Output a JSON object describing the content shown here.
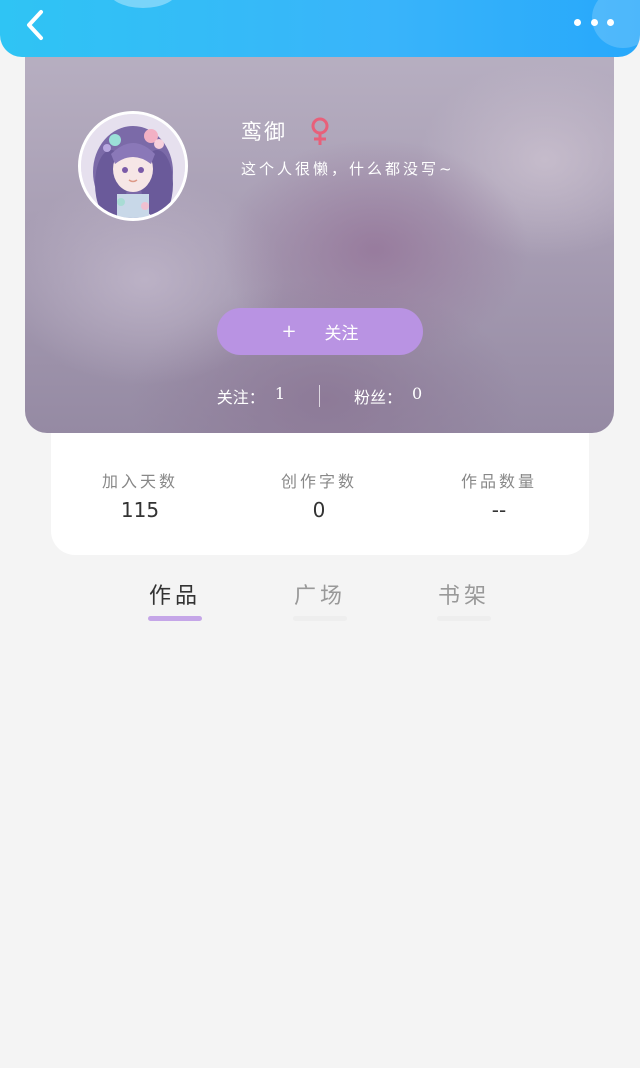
{
  "header": {
    "back_icon": "chevron-left-icon",
    "more_icon": "more-dots-icon",
    "accent_color": "#33b6f8"
  },
  "profile": {
    "name": "鸾御",
    "gender_icon": "female-symbol-icon",
    "gender_color": "#e8607a",
    "bio": "这个人很懒，什么都没写~",
    "follow_button_plus": "+",
    "follow_button_label": "关注",
    "follow_button_color": "#b993e3",
    "following_label": "关注：",
    "following_value": "1",
    "fans_label": "粉丝：",
    "fans_value": "0"
  },
  "stats": [
    {
      "label": "加入天数",
      "value": "115"
    },
    {
      "label": "创作字数",
      "value": "0"
    },
    {
      "label": "作品数量",
      "value": "--"
    }
  ],
  "tabs": [
    {
      "label": "作品",
      "active": true
    },
    {
      "label": "广场",
      "active": false
    },
    {
      "label": "书架",
      "active": false
    }
  ]
}
